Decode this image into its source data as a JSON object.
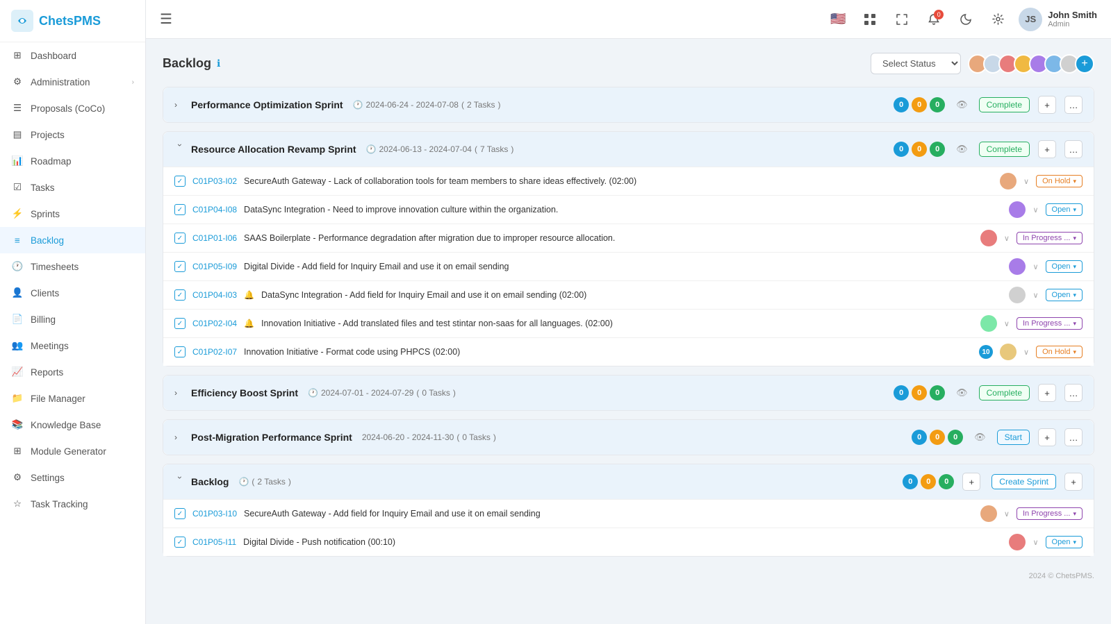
{
  "app": {
    "name": "ChetsPMS",
    "logo_text": "ChetsPMS"
  },
  "sidebar": {
    "items": [
      {
        "id": "dashboard",
        "label": "Dashboard",
        "icon": "grid"
      },
      {
        "id": "administration",
        "label": "Administration",
        "icon": "settings",
        "arrow": true
      },
      {
        "id": "proposals",
        "label": "Proposals (CoCo)",
        "icon": "file"
      },
      {
        "id": "projects",
        "label": "Projects",
        "icon": "folder"
      },
      {
        "id": "roadmap",
        "label": "Roadmap",
        "icon": "bar-chart"
      },
      {
        "id": "tasks",
        "label": "Tasks",
        "icon": "check-square"
      },
      {
        "id": "sprints",
        "label": "Sprints",
        "icon": "zap"
      },
      {
        "id": "backlog",
        "label": "Backlog",
        "icon": "list",
        "active": true
      },
      {
        "id": "timesheets",
        "label": "Timesheets",
        "icon": "clock"
      },
      {
        "id": "clients",
        "label": "Clients",
        "icon": "user"
      },
      {
        "id": "billing",
        "label": "Billing",
        "icon": "file-text"
      },
      {
        "id": "meetings",
        "label": "Meetings",
        "icon": "users"
      },
      {
        "id": "reports",
        "label": "Reports",
        "icon": "trending-up"
      },
      {
        "id": "file-manager",
        "label": "File Manager",
        "icon": "folder-open"
      },
      {
        "id": "knowledge-base",
        "label": "Knowledge Base",
        "icon": "book"
      },
      {
        "id": "module-generator",
        "label": "Module Generator",
        "icon": "grid"
      },
      {
        "id": "settings",
        "label": "Settings",
        "icon": "settings"
      },
      {
        "id": "task-tracking",
        "label": "Task Tracking",
        "icon": "star"
      }
    ]
  },
  "topbar": {
    "menu_icon": "☰",
    "notification_count": "0",
    "user": {
      "name": "John Smith",
      "role": "Admin",
      "initials": "JS"
    }
  },
  "page": {
    "title": "Backlog",
    "status_placeholder": "Select Status",
    "footer": "2024 © ChetsPMS."
  },
  "sprints": [
    {
      "id": "sprint1",
      "name": "Performance Optimization Sprint",
      "dates": "2024-06-24 - 2024-07-08",
      "task_count": "2 Tasks",
      "expanded": false,
      "badges": [
        0,
        0,
        0
      ],
      "status_btn": "Complete",
      "status_type": "complete",
      "tasks": []
    },
    {
      "id": "sprint2",
      "name": "Resource Allocation Revamp Sprint",
      "dates": "2024-06-13 - 2024-07-04",
      "task_count": "7 Tasks",
      "expanded": true,
      "badges": [
        0,
        0,
        0
      ],
      "status_btn": "Complete",
      "status_type": "complete",
      "tasks": [
        {
          "id": "C01P03-I02",
          "desc": "SecureAuth Gateway - Lack of collaboration tools for team members to share ideas effectively. (02:00)",
          "avatar": "A1",
          "status": "On Hold",
          "status_type": "on-hold",
          "has_icon": false
        },
        {
          "id": "C01P04-I08",
          "desc": "DataSync Integration - Need to improve innovation culture within the organization.",
          "avatar": "A2",
          "status": "Open",
          "status_type": "open",
          "has_icon": false
        },
        {
          "id": "C01P01-I06",
          "desc": "SAAS Boilerplate - Performance degradation after migration due to improper resource allocation.",
          "avatar": "A3",
          "status": "In Progress ...",
          "status_type": "in-progress",
          "has_icon": false
        },
        {
          "id": "C01P05-I09",
          "desc": "Digital Divide - Add field for Inquiry Email and use it on email sending",
          "avatar": "A4",
          "status": "Open",
          "status_type": "open",
          "has_icon": false
        },
        {
          "id": "C01P04-I03",
          "desc": "DataSync Integration - Add field for Inquiry Email and use it on email sending (02:00)",
          "avatar": "unknown",
          "status": "Open",
          "status_type": "open",
          "has_icon": true
        },
        {
          "id": "C01P02-I04",
          "desc": "Innovation Initiative - Add translated files and test stintar non-saas for all languages. (02:00)",
          "avatar": "A5",
          "status": "In Progress ...",
          "status_type": "in-progress",
          "has_icon": true
        },
        {
          "id": "C01P02-I07",
          "desc": "Innovation Initiative - Format code using PHPCS (02:00)",
          "avatar": "A6",
          "status": "On Hold",
          "status_type": "on-hold",
          "has_icon": false,
          "badge": 10
        }
      ]
    },
    {
      "id": "sprint3",
      "name": "Efficiency Boost Sprint",
      "dates": "2024-07-01 - 2024-07-29",
      "task_count": "0 Tasks",
      "expanded": false,
      "badges": [
        0,
        0,
        0
      ],
      "status_btn": "Complete",
      "status_type": "complete",
      "tasks": []
    },
    {
      "id": "sprint4",
      "name": "Post-Migration Performance Sprint",
      "dates": "2024-06-20 - 2024-11-30",
      "task_count": "0 Tasks",
      "expanded": false,
      "badges": [
        0,
        0,
        0
      ],
      "status_btn": "Start",
      "status_type": "start",
      "tasks": []
    }
  ],
  "backlog_section": {
    "name": "Backlog",
    "task_count": "2 Tasks",
    "badges": [
      0,
      0,
      0
    ],
    "expanded": true,
    "tasks": [
      {
        "id": "C01P03-I10",
        "desc": "SecureAuth Gateway - Add field for Inquiry Email and use it on email sending",
        "avatar": "A1",
        "status": "In Progress ...",
        "status_type": "in-progress"
      },
      {
        "id": "C01P05-I11",
        "desc": "Digital Divide - Push notification (00:10)",
        "avatar": "A3",
        "status": "Open",
        "status_type": "open"
      }
    ]
  },
  "avatar_colors": {
    "A1": "#e8a87c",
    "A2": "#7cb8e8",
    "A3": "#e87c7c",
    "A4": "#a87ce8",
    "A5": "#7ce8a8",
    "A6": "#e8c87c",
    "unknown": "#d0d0d0"
  }
}
